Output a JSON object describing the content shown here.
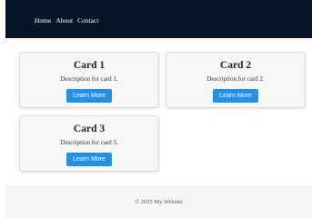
{
  "navbar": {
    "links": [
      {
        "label": "Home"
      },
      {
        "label": "About"
      },
      {
        "label": "Contact"
      }
    ]
  },
  "cards": [
    {
      "title": "Card 1",
      "description": "Description for card 1.",
      "button_label": "Learn More"
    },
    {
      "title": "Card 2",
      "description": "Description for card 2.",
      "button_label": "Learn More"
    },
    {
      "title": "Card 3",
      "description": "Description for card 3.",
      "button_label": "Learn More"
    }
  ],
  "footer": {
    "text": "© 2025 My Website"
  },
  "colors": {
    "navbar_background": "#061525",
    "accent_button": "#1f91ea",
    "card_background": "#f7f7f7",
    "footer_background": "#f5f5f5"
  }
}
